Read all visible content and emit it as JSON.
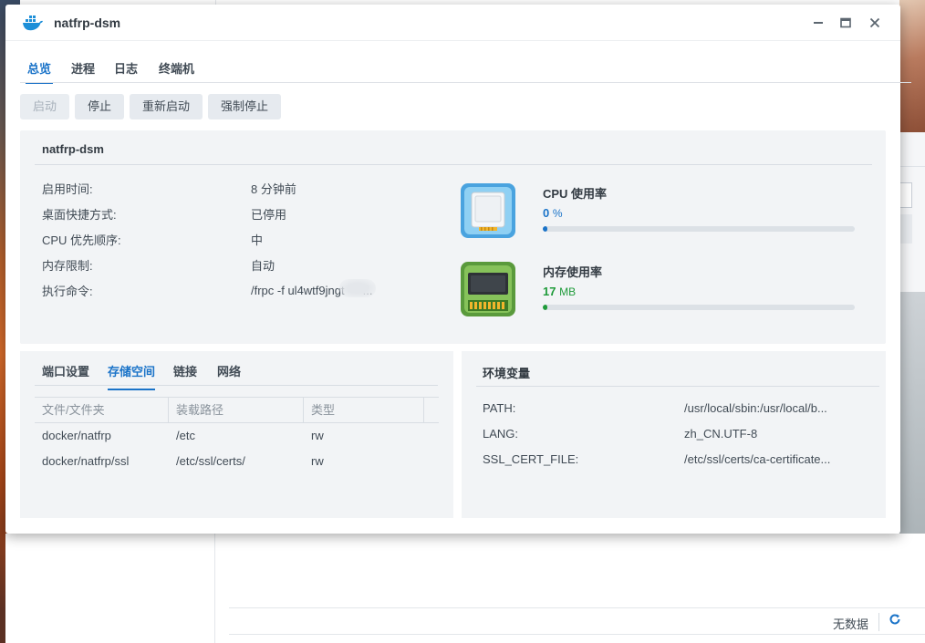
{
  "window": {
    "title": "natfrp-dsm"
  },
  "tabs": [
    {
      "label": "总览",
      "active": true
    },
    {
      "label": "进程",
      "active": false
    },
    {
      "label": "日志",
      "active": false
    },
    {
      "label": "终端机",
      "active": false
    }
  ],
  "toolbar": {
    "start_label": "启动",
    "stop_label": "停止",
    "restart_label": "重新启动",
    "force_stop_label": "强制停止"
  },
  "info": {
    "name": "natfrp-dsm",
    "fields": [
      {
        "label": "启用时间:",
        "value": "8 分钟前"
      },
      {
        "label": "桌面快捷方式:",
        "value": "已停用"
      },
      {
        "label": "CPU 优先顺序:",
        "value": "中"
      },
      {
        "label": "内存限制:",
        "value": "自动"
      },
      {
        "label": "执行命令:",
        "value": "/frpc -f ul4wtf9jngt",
        "value_suffix": "..."
      }
    ]
  },
  "metrics": {
    "cpu": {
      "label": "CPU 使用率",
      "value": "0",
      "unit": "%",
      "color": "#1a73c8",
      "fraction": 0.015
    },
    "memory": {
      "label": "内存使用率",
      "value": "17",
      "unit": "MB",
      "color": "#1f9b3a",
      "fraction": 0.015
    }
  },
  "storage": {
    "subtabs": [
      {
        "label": "端口设置",
        "active": false
      },
      {
        "label": "存储空间",
        "active": true
      },
      {
        "label": "链接",
        "active": false
      },
      {
        "label": "网络",
        "active": false
      }
    ],
    "columns": [
      "文件/文件夹",
      "装载路径",
      "类型"
    ],
    "rows": [
      [
        "docker/natfrp",
        "/etc",
        "rw"
      ],
      [
        "docker/natfrp/ssl",
        "/etc/ssl/certs/",
        "rw"
      ]
    ]
  },
  "env": {
    "title": "环境变量",
    "vars": [
      {
        "key": "PATH:",
        "value": "/usr/local/sbin:/usr/local/b..."
      },
      {
        "key": "LANG:",
        "value": "zh_CN.UTF-8"
      },
      {
        "key": "SSL_CERT_FILE:",
        "value": "/etc/ssl/certs/ca-certificate..."
      }
    ]
  },
  "background": {
    "status_text": "无数据"
  },
  "colors": {
    "accent": "#1a73c8",
    "panel_bg": "#f2f4f6",
    "memory_green": "#1f9b3a"
  }
}
